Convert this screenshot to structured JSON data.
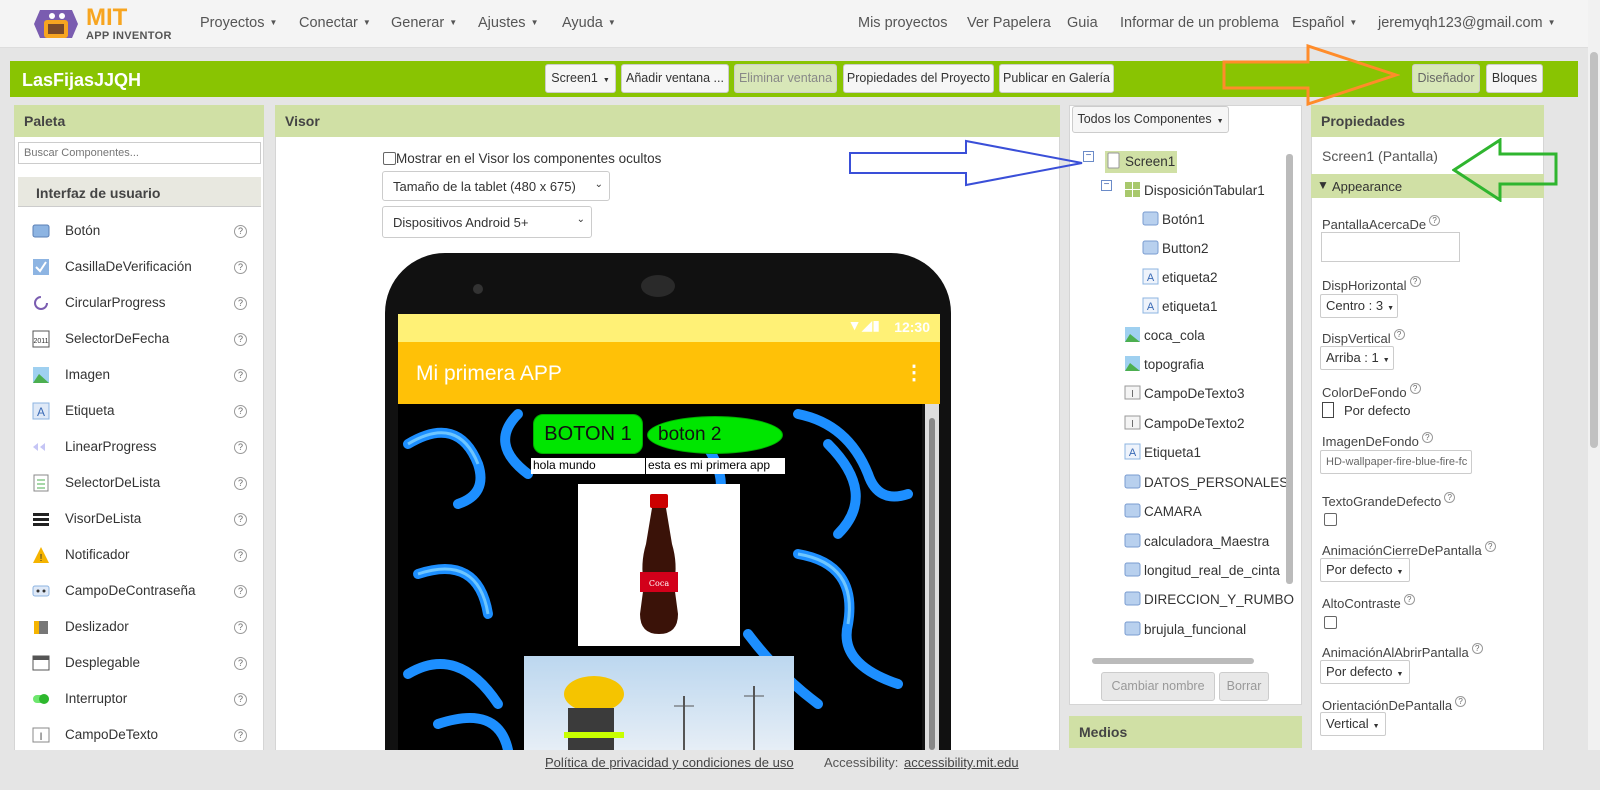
{
  "brand": {
    "mit": "MIT",
    "app": "APP INVENTOR"
  },
  "nav": {
    "left": [
      "Proyectos",
      "Conectar",
      "Generar",
      "Ajustes",
      "Ayuda"
    ],
    "right": [
      "Mis proyectos",
      "Ver Papelera",
      "Guia",
      "Informar de un problema",
      "Español",
      "jeremyqh123@gmail.com"
    ]
  },
  "toolbar": {
    "project": "LasFijasJJQH",
    "screen": "Screen1",
    "add": "Añadir ventana ...",
    "remove": "Eliminar ventana",
    "props": "Propiedades del Proyecto",
    "publish": "Publicar en Galería",
    "designer": "Diseñador",
    "blocks": "Bloques"
  },
  "palette": {
    "title": "Paleta",
    "search_placeholder": "Buscar Componentes...",
    "section": "Interfaz de usuario",
    "items": [
      {
        "label": "Botón",
        "icon": "button-icon"
      },
      {
        "label": "CasillaDeVerificación",
        "icon": "checkbox-icon"
      },
      {
        "label": "CircularProgress",
        "icon": "circular-progress-icon"
      },
      {
        "label": "SelectorDeFecha",
        "icon": "date-picker-icon"
      },
      {
        "label": "Imagen",
        "icon": "image-icon"
      },
      {
        "label": "Etiqueta",
        "icon": "label-icon"
      },
      {
        "label": "LinearProgress",
        "icon": "linear-progress-icon"
      },
      {
        "label": "SelectorDeLista",
        "icon": "list-picker-icon"
      },
      {
        "label": "VisorDeLista",
        "icon": "list-view-icon"
      },
      {
        "label": "Notificador",
        "icon": "notifier-icon"
      },
      {
        "label": "CampoDeContraseña",
        "icon": "password-icon"
      },
      {
        "label": "Deslizador",
        "icon": "slider-icon"
      },
      {
        "label": "Desplegable",
        "icon": "spinner-icon"
      },
      {
        "label": "Interruptor",
        "icon": "switch-icon"
      },
      {
        "label": "CampoDeTexto",
        "icon": "textbox-icon"
      }
    ]
  },
  "viewer": {
    "title": "Visor",
    "hidden_check": "Mostrar en el Visor los componentes ocultos",
    "size_select": "Tamaño de la tablet (480 x 675)",
    "device_select": "Dispositivos Android 5+",
    "app": {
      "time": "12:30",
      "title": "Mi primera APP",
      "btn1": "BOTON 1",
      "btn2": "boton 2",
      "lbl1": "hola mundo",
      "lbl2": "esta es mi primera app"
    }
  },
  "components": {
    "filter": "Todos los Componentes",
    "rename": "Cambiar nombre",
    "delete": "Borrar",
    "media": "Medios",
    "tree": [
      "Screen1",
      "DisposiciónTabular1",
      "Botón1",
      "Button2",
      "etiqueta2",
      "etiqueta1",
      "coca_cola",
      "topografia",
      "CampoDeTexto3",
      "CampoDeTexto2",
      "Etiqueta1",
      "DATOS_PERSONALES",
      "CAMARA",
      "calculadora_Maestra",
      "longitud_real_de_cinta",
      "DIRECCION_Y_RUMBO",
      "brujula_funcional"
    ]
  },
  "properties": {
    "title": "Propiedades",
    "screen": "Screen1 (Pantalla)",
    "group": "Appearance",
    "about": "PantallaAcercaDe",
    "halign": "DispHorizontal",
    "halign_val": "Centro : 3",
    "valign": "DispVertical",
    "valign_val": "Arriba : 1",
    "bgcolor": "ColorDeFondo",
    "bgcolor_val": "Por defecto",
    "bgimage": "ImagenDeFondo",
    "bgimage_val": "HD-wallpaper-fire-blue-fire-fc",
    "bigfont": "TextoGrandeDefecto",
    "close_anim": "AnimaciónCierreDePantalla",
    "close_anim_val": "Por defecto",
    "contrast": "AltoContraste",
    "open_anim": "AnimaciónAlAbrirPantalla",
    "open_anim_val": "Por defecto",
    "orient": "OrientaciónDePantalla",
    "orient_val": "Vertical"
  },
  "footer": {
    "privacy": "Política de privacidad y condiciones de uso",
    "access_label": "Accessibility:",
    "access_link": "accessibility.mit.edu"
  },
  "colors": {
    "green_bar": "#89c402",
    "panel_header": "#d0e0a5",
    "app_bar": "#ffc107",
    "status_bar": "#fff176",
    "app_button": "#00e600",
    "arrow_orange": "#ff8c2a",
    "arrow_blue": "#3a4fd8",
    "arrow_green": "#2fb52f"
  }
}
